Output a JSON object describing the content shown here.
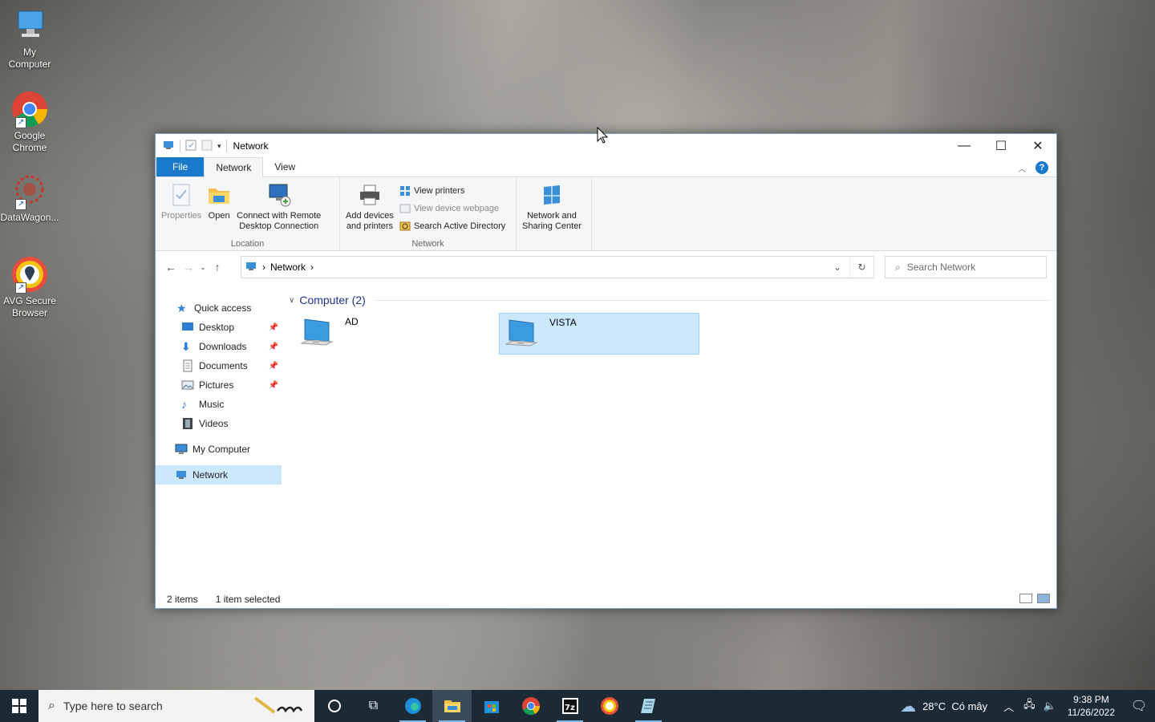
{
  "desktop": {
    "icons": [
      {
        "label": "My\nComputer",
        "label1": "My",
        "label2": "Computer"
      },
      {
        "label1": "Google",
        "label2": "Chrome"
      },
      {
        "label1": "DataWagon...",
        "label2": ""
      },
      {
        "label1": "AVG Secure",
        "label2": "Browser"
      }
    ]
  },
  "window": {
    "title": "Network",
    "tabs": {
      "file": "File",
      "network": "Network",
      "view": "View"
    },
    "ribbon": {
      "location_group": "Location",
      "network_group": "Network",
      "properties": "Properties",
      "open": "Open",
      "connect_remote_1": "Connect with Remote",
      "connect_remote_2": "Desktop Connection",
      "add_devices_1": "Add devices",
      "add_devices_2": "and printers",
      "view_printers": "View printers",
      "view_device_webpage": "View device webpage",
      "search_ad": "Search Active Directory",
      "network_sharing_1": "Network and",
      "network_sharing_2": "Sharing Center"
    },
    "address": {
      "crumb": "Network",
      "sep": "›"
    },
    "search": {
      "placeholder": "Search Network"
    },
    "nav": {
      "quick_access": "Quick access",
      "desktop": "Desktop",
      "downloads": "Downloads",
      "documents": "Documents",
      "pictures": "Pictures",
      "music": "Music",
      "videos": "Videos",
      "my_computer": "My Computer",
      "network": "Network"
    },
    "group_header": "Computer (2)",
    "items": [
      {
        "name": "AD",
        "selected": false
      },
      {
        "name": "VISTA",
        "selected": true
      }
    ],
    "status": {
      "count": "2 items",
      "selection": "1 item selected"
    }
  },
  "taskbar": {
    "search_placeholder": "Type here to search",
    "weather": "28°C  Có mây",
    "time": "9:38 PM",
    "date": "11/26/2022"
  },
  "colors": {
    "accent": "#1979ca",
    "selection": "#cce8ff",
    "taskbar": "#1c2a36"
  }
}
